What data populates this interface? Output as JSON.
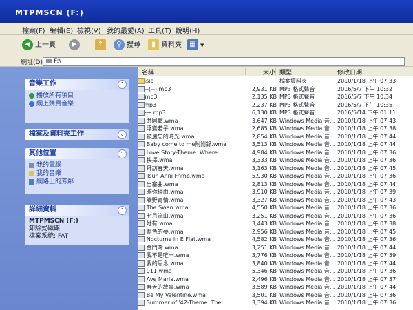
{
  "window": {
    "title": "MTPMSCN (F:)"
  },
  "menubar": [
    "檔案(F)",
    "編輯(E)",
    "檢視(V)",
    "我的最愛(A)",
    "工具(T)",
    "說明(H)"
  ],
  "toolbar": {
    "back_label": "上一頁",
    "search_label": "搜尋",
    "folders_label": "資料夾"
  },
  "address": {
    "label": "網址(D)",
    "value": "F:\\"
  },
  "side": {
    "music_tasks": {
      "title": "音樂工作",
      "items": [
        "播放所有項目",
        "網上購買音樂"
      ]
    },
    "file_tasks": {
      "title": "檔案及資料夾工作"
    },
    "other_places": {
      "title": "其他位置",
      "items": [
        "我的電腦",
        "我的音樂",
        "網路上的芳鄰"
      ]
    },
    "details": {
      "title": "詳細資料",
      "name": "MTPMSCN (F:)",
      "type": "卸除式磁碟",
      "filesystem": "檔案系統: FAT"
    }
  },
  "columns": {
    "name": "名稱",
    "size": "大小",
    "type": "類型",
    "modified": "修改日期"
  },
  "files": [
    {
      "name": "Music",
      "size": "",
      "type": "檔案資料夾",
      "date": "2010/1/18 上午 07:33",
      "folder": true
    },
    {
      "name": "——(--).mp3",
      "size": "2,931 KB",
      "type": "MP3 格式聲音",
      "date": "2016/5/7 下午 10:32"
    },
    {
      "name": "—.mp3",
      "size": "2,135 KB",
      "type": "MP3 格式聲音",
      "date": "2016/5/7 下午 10:34"
    },
    {
      "name": "+.mp3",
      "size": "2,237 KB",
      "type": "MP3 格式聲音",
      "date": "2016/5/7 下午 10:35"
    },
    {
      "name": "+++.mp3",
      "size": "6,130 KB",
      "type": "MP3 格式聲音",
      "date": "2016/5/14 下午 01:11"
    },
    {
      "name": "01 共同體.wma",
      "size": "3,647 KB",
      "type": "Windows Media 音...",
      "date": "2010/1/18 上午 07:43"
    },
    {
      "name": "01 浮變若子.wma",
      "size": "2,685 KB",
      "type": "Windows Media 音...",
      "date": "2010/1/18 上午 07:38"
    },
    {
      "name": "01 被遺忘的時光.wma",
      "size": "2,854 KB",
      "type": "Windows Media 音...",
      "date": "2010/1/18 上午 07:44"
    },
    {
      "name": "02 Baby come to me附附錄.wma",
      "size": "3,513 KB",
      "type": "Windows Media 音...",
      "date": "2010/1/18 上午 07:44"
    },
    {
      "name": "02 Love Story-Theme. Where ...",
      "size": "4,984 KB",
      "type": "Windows Media 音...",
      "date": "2010/1/18 上午 07:36"
    },
    {
      "name": "02 抉擇.wma",
      "size": "3,333 KB",
      "type": "Windows Media 音...",
      "date": "2010/1/18 上午 07:36"
    },
    {
      "name": "02 拜訪春天.wma",
      "size": "3,163 KB",
      "type": "Windows Media 音...",
      "date": "2010/1/18 上午 07:45"
    },
    {
      "name": "03 Tsuh Anni Frime.wma",
      "size": "5,930 KB",
      "type": "Windows Media 音...",
      "date": "2010/1/18 上午 07:36"
    },
    {
      "name": "03 出塞曲.wma",
      "size": "2,813 KB",
      "type": "Windows Media 音...",
      "date": "2010/1/18 上午 07:44"
    },
    {
      "name": "03 昨你理由.wma",
      "size": "3,910 KB",
      "type": "Windows Media 音...",
      "date": "2010/1/18 上午 07:39"
    },
    {
      "name": "03 曠野寄情.wma",
      "size": "3,327 KB",
      "type": "Windows Media 音...",
      "date": "2010/1/18 上午 07:43"
    },
    {
      "name": "04 The Swan.wma",
      "size": "4,550 KB",
      "type": "Windows Media 音...",
      "date": "2010/1/18 上午 07:36"
    },
    {
      "name": "04 七月流山.wma",
      "size": "3,251 KB",
      "type": "Windows Media 音...",
      "date": "2010/1/18 上午 07:36"
    },
    {
      "name": "04 她有.wma",
      "size": "3,443 KB",
      "type": "Windows Media 音...",
      "date": "2010/1/18 上午 07:38"
    },
    {
      "name": "04 藍色的夢.wma",
      "size": "2,956 KB",
      "type": "Windows Media 音...",
      "date": "2010/1/18 上午 07:45"
    },
    {
      "name": "05 Nocturne in E Flat.wma",
      "size": "4,582 KB",
      "type": "Windows Media 音...",
      "date": "2010/1/18 上午 07:36"
    },
    {
      "name": "05 金門灣.wma",
      "size": "3,251 KB",
      "type": "Windows Media 音...",
      "date": "2010/1/18 上午 07:44"
    },
    {
      "name": "05 我不是唯一.wma",
      "size": "3,776 KB",
      "type": "Windows Media 音...",
      "date": "2010/1/18 上午 07:39"
    },
    {
      "name": "05 我的思念.wma",
      "size": "3,840 KB",
      "type": "Windows Media 音...",
      "date": "2010/1/18 上午 07:44"
    },
    {
      "name": "06 911.wma",
      "size": "5,346 KB",
      "type": "Windows Media 音...",
      "date": "2010/1/18 上午 07:36"
    },
    {
      "name": "06 Ave Maria.wma",
      "size": "2,496 KB",
      "type": "Windows Media 音...",
      "date": "2010/1/18 上午 07:37"
    },
    {
      "name": "06 春天的故事.wma",
      "size": "3,589 KB",
      "type": "Windows Media 音...",
      "date": "2010/1/18 上午 07:44"
    },
    {
      "name": "07 Be My Valentine.wma",
      "size": "3,501 KB",
      "type": "Windows Media 音...",
      "date": "2010/1/18 上午 07:36"
    },
    {
      "name": "07 Summer of '42-Theme. The...",
      "size": "3,394 KB",
      "type": "Windows Media 音...",
      "date": "2010/1/18 上午 07:36"
    }
  ]
}
